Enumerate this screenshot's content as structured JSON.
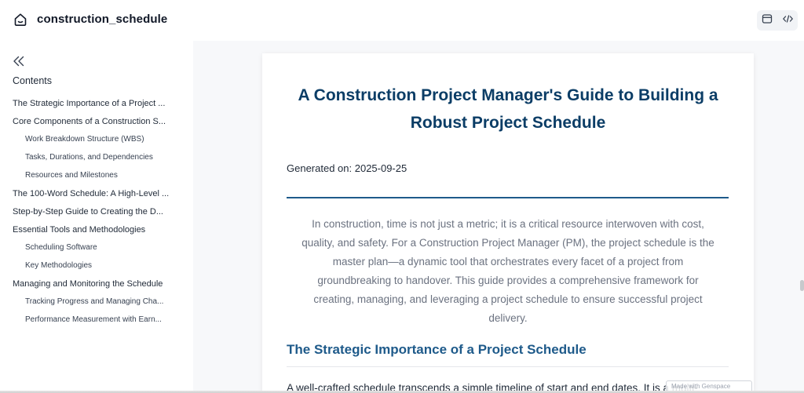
{
  "app": {
    "title": "construction_schedule",
    "home_icon": "home-icon",
    "actions": [
      {
        "name": "preview",
        "icon": "browser-window-icon"
      },
      {
        "name": "code",
        "icon": "code-brackets-icon"
      }
    ]
  },
  "sidebar": {
    "collapse_icon": "double-chevron-left-icon",
    "heading": "Contents",
    "items": [
      {
        "label": "The Strategic Importance of a Project ...",
        "level": 1
      },
      {
        "label": "Core Components of a Construction S...",
        "level": 1
      },
      {
        "label": "Work Breakdown Structure (WBS)",
        "level": 2
      },
      {
        "label": "Tasks, Durations, and Dependencies",
        "level": 2
      },
      {
        "label": "Resources and Milestones",
        "level": 2
      },
      {
        "label": "The 100-Word Schedule: A High-Level ...",
        "level": 1
      },
      {
        "label": "Step-by-Step Guide to Creating the D...",
        "level": 1
      },
      {
        "label": "Essential Tools and Methodologies",
        "level": 1
      },
      {
        "label": "Scheduling Software",
        "level": 2
      },
      {
        "label": "Key Methodologies",
        "level": 2
      },
      {
        "label": "Managing and Monitoring the Schedule",
        "level": 1
      },
      {
        "label": "Tracking Progress and Managing Cha...",
        "level": 2
      },
      {
        "label": "Performance Measurement with Earn...",
        "level": 2
      }
    ]
  },
  "document": {
    "title": "A Construction Project Manager's Guide to Building a Robust Project Schedule",
    "generated": "Generated on: 2025-09-25",
    "intro": "In construction, time is not just a metric; it is a critical resource interwoven with cost, quality, and safety. For a Construction Project Manager (PM), the project schedule is the master plan—a dynamic tool that orchestrates every facet of a project from groundbreaking to handover. This guide provides a comprehensive framework for creating, managing, and leveraging a project schedule to ensure successful project delivery.",
    "section_heading": "The Strategic Importance of a Project Schedule",
    "body_start": "A well-crafted schedule transcends a simple timeline of start and end dates. It is a multi-"
  },
  "overlay": {
    "watermark": "Made with Genspace"
  },
  "colors": {
    "title": "#0b3d66",
    "accent": "#1e5a8a",
    "muted_text": "#6b7280",
    "background": "#f7f8fa"
  }
}
